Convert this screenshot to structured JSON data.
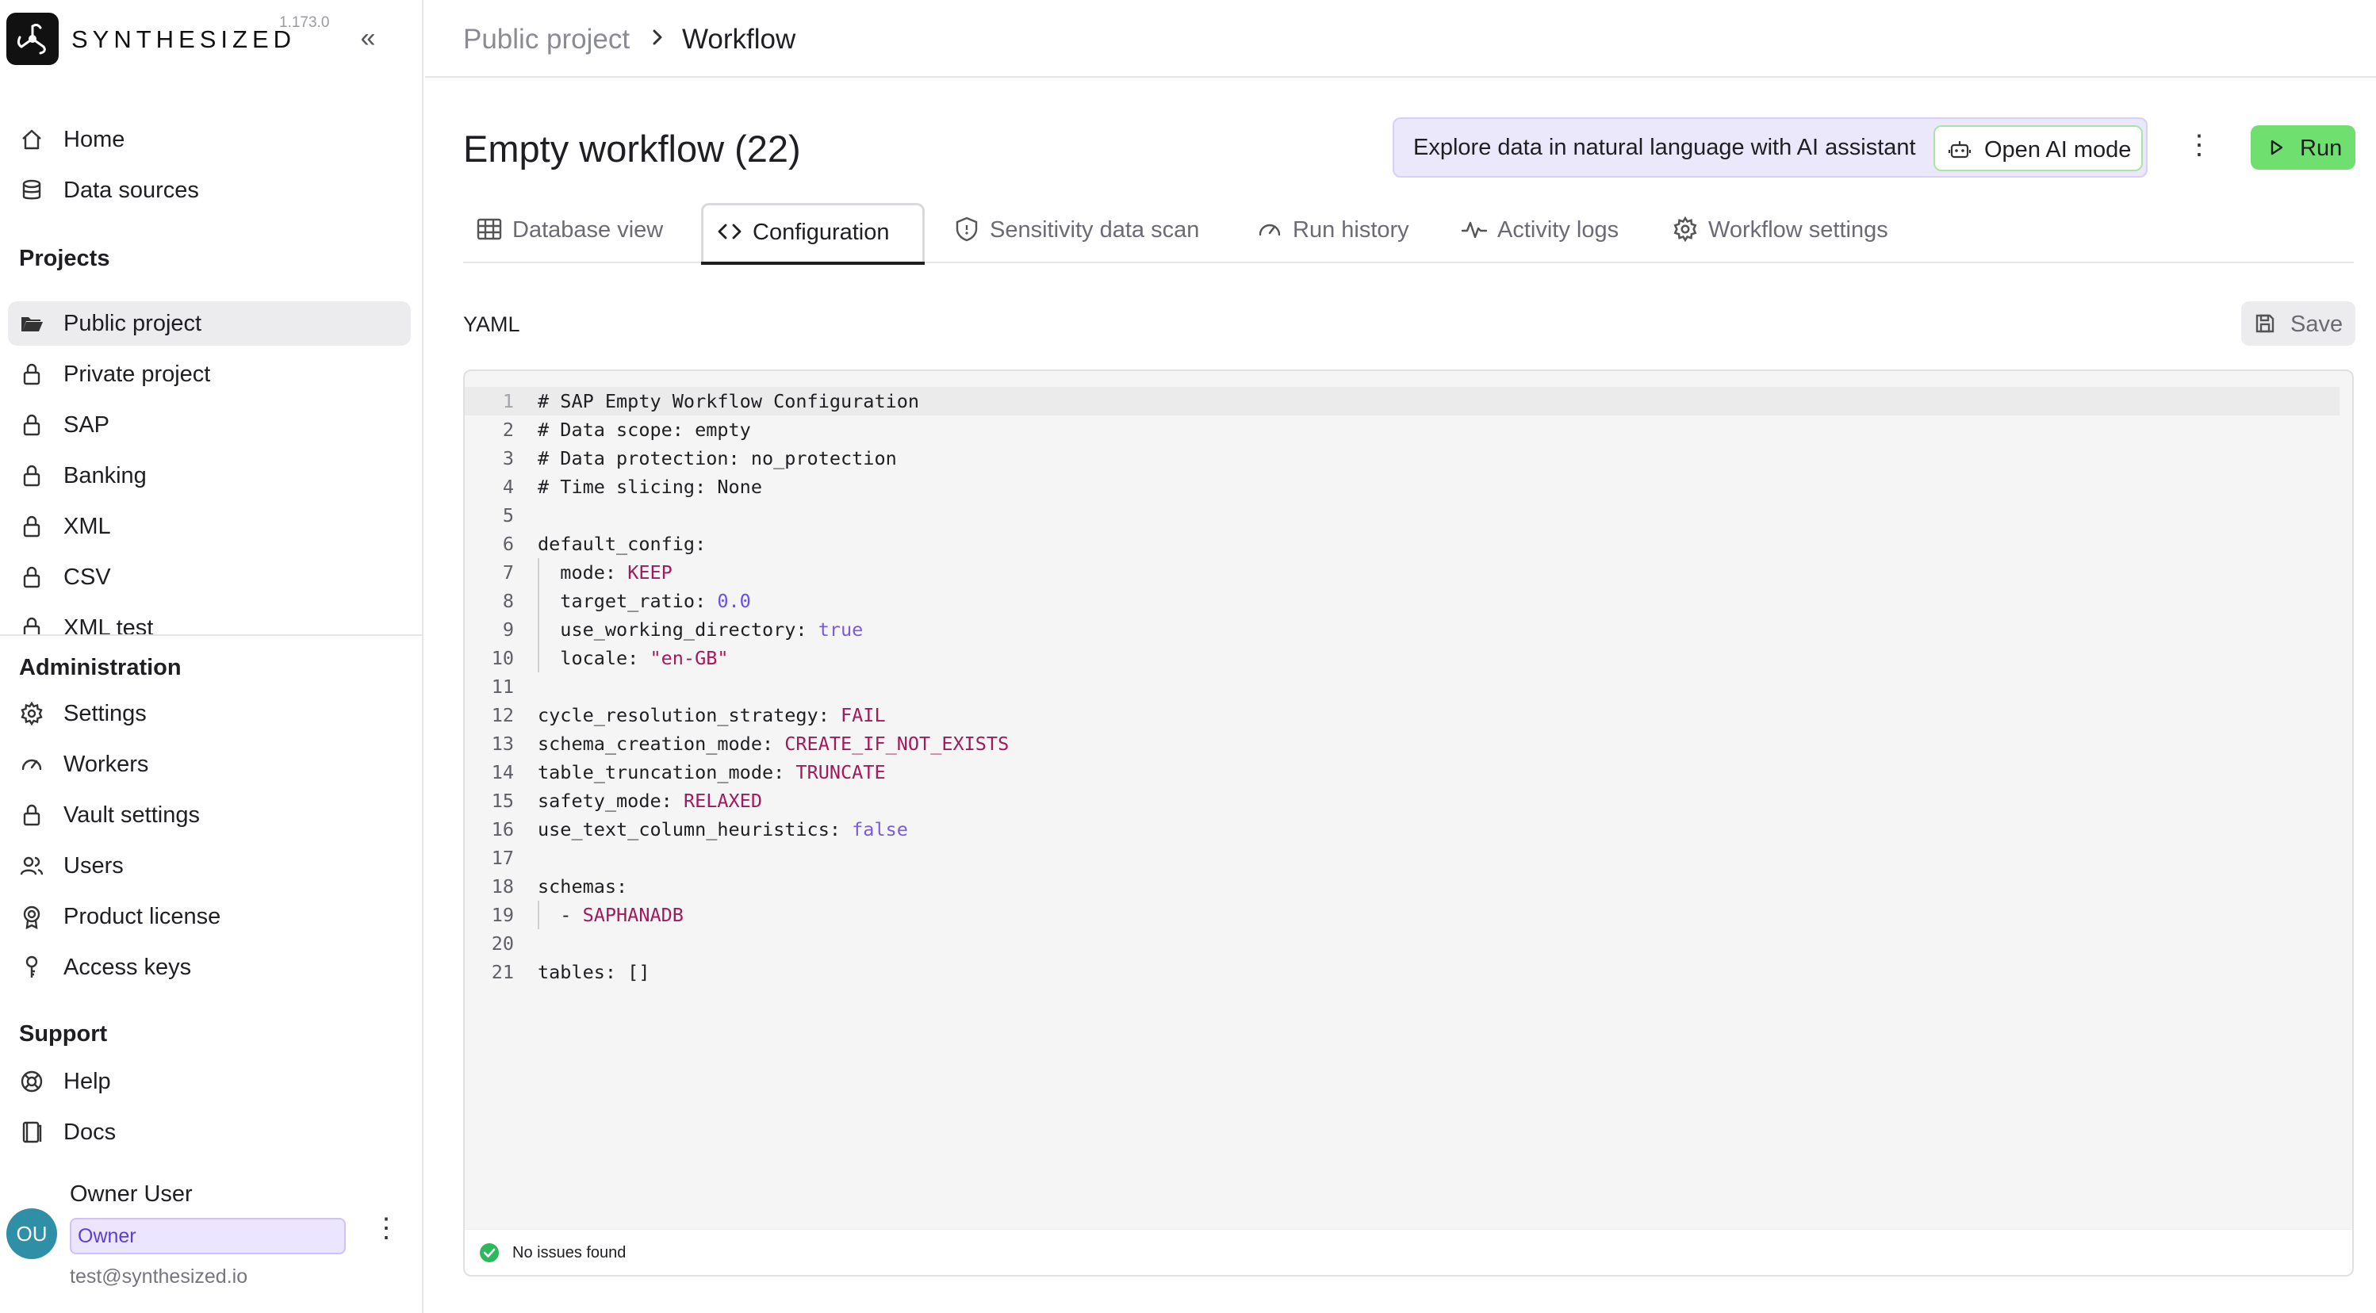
{
  "app": {
    "brand": "SYNTHESIZED",
    "version": "1.173.0"
  },
  "sidebar": {
    "top_items": [
      {
        "label": "Home",
        "icon": "home-icon"
      },
      {
        "label": "Data sources",
        "icon": "database-icon"
      }
    ],
    "projects_title": "Projects",
    "projects": [
      {
        "label": "Public project",
        "icon": "folder-open-icon",
        "active": true
      },
      {
        "label": "Private project",
        "icon": "lock-icon"
      },
      {
        "label": "SAP",
        "icon": "lock-icon"
      },
      {
        "label": "Banking",
        "icon": "lock-icon"
      },
      {
        "label": "XML",
        "icon": "lock-icon"
      },
      {
        "label": "CSV",
        "icon": "lock-icon"
      },
      {
        "label": "XML test",
        "icon": "lock-icon"
      }
    ],
    "admin_title": "Administration",
    "admin_items": [
      {
        "label": "Settings",
        "icon": "gear-icon"
      },
      {
        "label": "Workers",
        "icon": "gauge-icon"
      },
      {
        "label": "Vault settings",
        "icon": "lock-icon"
      },
      {
        "label": "Users",
        "icon": "users-icon"
      },
      {
        "label": "Product license",
        "icon": "badge-icon"
      },
      {
        "label": "Access keys",
        "icon": "key-icon"
      }
    ],
    "support_title": "Support",
    "support_items": [
      {
        "label": "Help",
        "icon": "lifebuoy-icon"
      },
      {
        "label": "Docs",
        "icon": "book-icon"
      }
    ],
    "user": {
      "initials": "OU",
      "name": "Owner User",
      "role": "Owner",
      "email": "test@synthesized.io"
    }
  },
  "breadcrumb": {
    "project": "Public project",
    "current": "Workflow"
  },
  "header": {
    "title": "Empty workflow (22)",
    "ai_banner_text": "Explore data in natural language with AI assistant",
    "ai_button_label": "Open AI mode",
    "run_label": "Run"
  },
  "tabs": [
    {
      "label": "Database view",
      "icon": "grid-icon"
    },
    {
      "label": "Configuration",
      "icon": "code-icon",
      "active": true
    },
    {
      "label": "Sensitivity data scan",
      "icon": "shield-icon"
    },
    {
      "label": "Run history",
      "icon": "gauge-icon"
    },
    {
      "label": "Activity logs",
      "icon": "activity-icon"
    },
    {
      "label": "Workflow settings",
      "icon": "gear-icon"
    }
  ],
  "editor": {
    "label": "YAML",
    "save_label": "Save",
    "status": "No issues found",
    "lines": [
      {
        "key": "# SAP Empty Workflow Configuration",
        "value": "",
        "type": "comment"
      },
      {
        "key": "# Data scope: empty",
        "value": "",
        "type": "comment"
      },
      {
        "key": "# Data protection: no_protection",
        "value": "",
        "type": "comment"
      },
      {
        "key": "# Time slicing: None",
        "value": "",
        "type": "comment"
      },
      {
        "key": "",
        "value": "",
        "type": "blank"
      },
      {
        "key": "default_config:",
        "value": "",
        "type": "key"
      },
      {
        "key": "  mode: ",
        "value": "KEEP",
        "type": "str",
        "indent": true
      },
      {
        "key": "  target_ratio: ",
        "value": "0.0",
        "type": "num",
        "indent": true
      },
      {
        "key": "  use_working_directory: ",
        "value": "true",
        "type": "kw",
        "indent": true
      },
      {
        "key": "  locale: ",
        "value": "\"en-GB\"",
        "type": "str",
        "indent": true
      },
      {
        "key": "",
        "value": "",
        "type": "blank"
      },
      {
        "key": "cycle_resolution_strategy: ",
        "value": "FAIL",
        "type": "str"
      },
      {
        "key": "schema_creation_mode: ",
        "value": "CREATE_IF_NOT_EXISTS",
        "type": "str"
      },
      {
        "key": "table_truncation_mode: ",
        "value": "TRUNCATE",
        "type": "str"
      },
      {
        "key": "safety_mode: ",
        "value": "RELAXED",
        "type": "str"
      },
      {
        "key": "use_text_column_heuristics: ",
        "value": "false",
        "type": "kw"
      },
      {
        "key": "",
        "value": "",
        "type": "blank"
      },
      {
        "key": "schemas:",
        "value": "",
        "type": "key"
      },
      {
        "key": "  - ",
        "value": "SAPHANADB",
        "type": "str",
        "indent": true
      },
      {
        "key": "",
        "value": "",
        "type": "blank"
      },
      {
        "key": "tables: []",
        "value": "",
        "type": "key"
      }
    ]
  }
}
